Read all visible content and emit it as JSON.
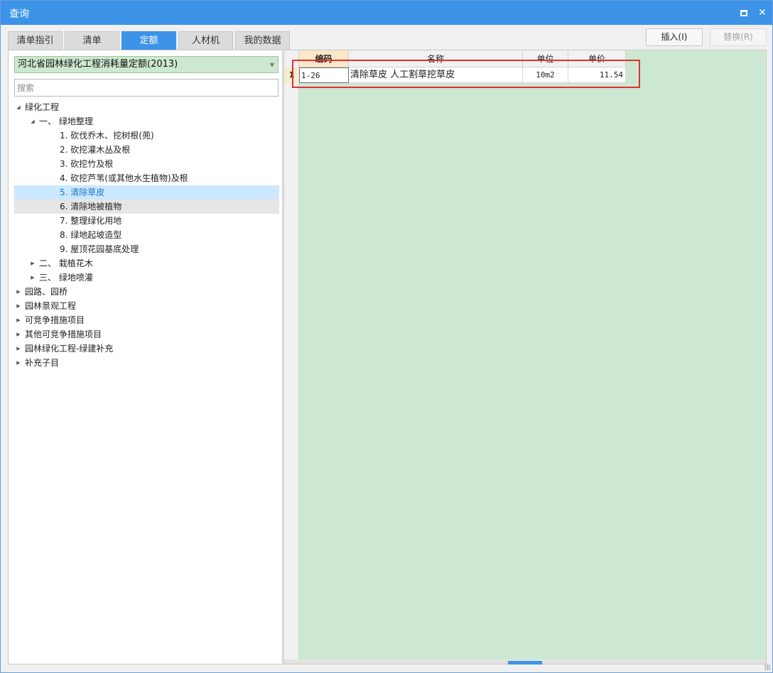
{
  "window": {
    "title": "查询"
  },
  "tabs": [
    {
      "label": "清单指引",
      "active": false
    },
    {
      "label": "清单",
      "active": false
    },
    {
      "label": "定额",
      "active": true
    },
    {
      "label": "人材机",
      "active": false
    },
    {
      "label": "我的数据",
      "active": false
    }
  ],
  "toolbar": {
    "insert_label": "插入(I)",
    "replace_label": "替换(R)"
  },
  "library": {
    "selected": "河北省园林绿化工程消耗量定额(2013)"
  },
  "search": {
    "placeholder": "搜索",
    "value": ""
  },
  "tree": [
    {
      "label": "绿化工程",
      "level": 0,
      "toggle": "expanded"
    },
    {
      "label": "一、 绿地整理",
      "level": 1,
      "toggle": "expanded"
    },
    {
      "label": "1. 砍伐乔木、挖树根(蔸)",
      "level": 2,
      "toggle": "none"
    },
    {
      "label": "2. 砍挖灌木丛及根",
      "level": 2,
      "toggle": "none"
    },
    {
      "label": "3. 砍挖竹及根",
      "level": 2,
      "toggle": "none"
    },
    {
      "label": "4. 砍挖芦苇(或其他水生植物)及根",
      "level": 2,
      "toggle": "none"
    },
    {
      "label": "5. 清除草皮",
      "level": 2,
      "toggle": "none",
      "state": "selected"
    },
    {
      "label": "6. 清除地被植物",
      "level": 2,
      "toggle": "none",
      "state": "hovered"
    },
    {
      "label": "7. 整理绿化用地",
      "level": 2,
      "toggle": "none"
    },
    {
      "label": "8. 绿地起坡造型",
      "level": 2,
      "toggle": "none"
    },
    {
      "label": "9. 屋顶花园基底处理",
      "level": 2,
      "toggle": "none"
    },
    {
      "label": "二、 栽植花木",
      "level": 1,
      "toggle": "collapsed"
    },
    {
      "label": "三、 绿地喷灌",
      "level": 1,
      "toggle": "collapsed"
    },
    {
      "label": "园路、园桥",
      "level": 0,
      "toggle": "collapsed"
    },
    {
      "label": "园林景观工程",
      "level": 0,
      "toggle": "collapsed"
    },
    {
      "label": "可竞争措施项目",
      "level": 0,
      "toggle": "collapsed"
    },
    {
      "label": "其他可竞争措施项目",
      "level": 0,
      "toggle": "collapsed"
    },
    {
      "label": "园林绿化工程-绿建补充",
      "level": 0,
      "toggle": "collapsed"
    },
    {
      "label": "补充子目",
      "level": 0,
      "toggle": "collapsed"
    }
  ],
  "grid": {
    "columns": [
      "编码",
      "名称",
      "单位",
      "单价"
    ],
    "rows": [
      {
        "num": "1",
        "code": "1-26",
        "name": "清除草皮 人工割草挖草皮",
        "unit": "10m2",
        "price": "11.54"
      }
    ]
  },
  "colors": {
    "accent": "#3c93e8",
    "green_area": "#cce8d2",
    "highlight": "#e03131",
    "selected_node": "#cce8ff"
  }
}
